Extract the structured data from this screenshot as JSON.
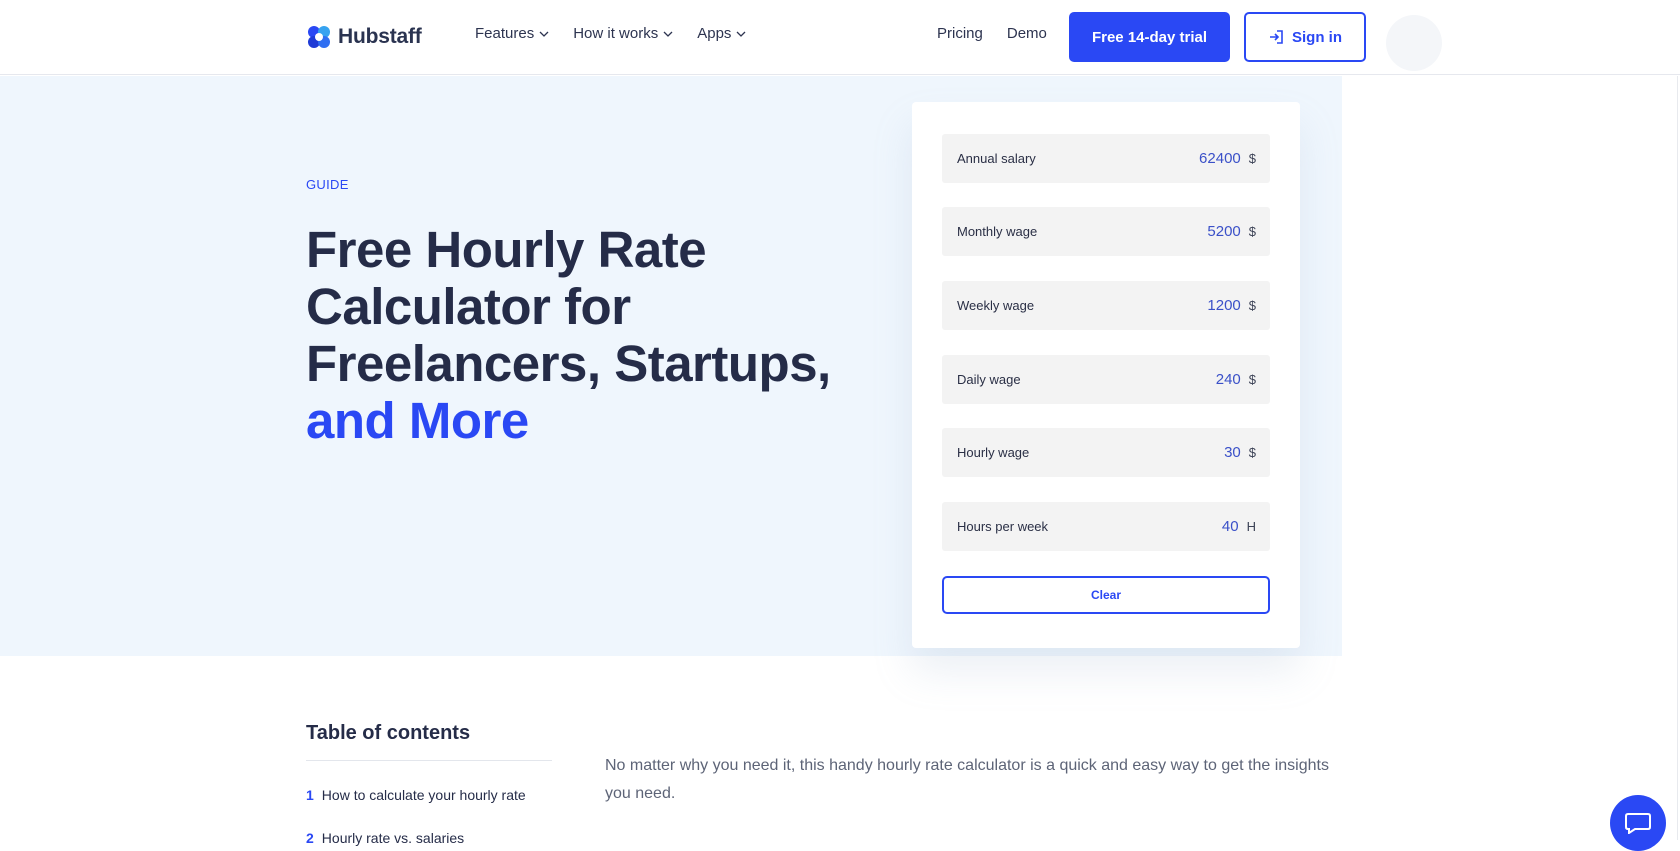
{
  "header": {
    "logo_text": "Hubstaff",
    "nav": [
      {
        "label": "Features"
      },
      {
        "label": "How it works"
      },
      {
        "label": "Apps"
      }
    ],
    "pricing_label": "Pricing",
    "demo_label": "Demo",
    "trial_label": "Free 14-day trial",
    "signin_label": "Sign in"
  },
  "hero": {
    "guide_label": "GUIDE",
    "title_line1": "Free Hourly Rate",
    "title_line2": "Calculator for",
    "title_line3": "Freelancers, Startups,",
    "title_accent": "and More"
  },
  "calculator": {
    "fields": [
      {
        "label": "Annual salary",
        "value": "62400",
        "unit": "$"
      },
      {
        "label": "Monthly wage",
        "value": "5200",
        "unit": "$"
      },
      {
        "label": "Weekly wage",
        "value": "1200",
        "unit": "$"
      },
      {
        "label": "Daily wage",
        "value": "240",
        "unit": "$"
      },
      {
        "label": "Hourly wage",
        "value": "30",
        "unit": "$"
      },
      {
        "label": "Hours per week",
        "value": "40",
        "unit": "H"
      }
    ],
    "clear_label": "Clear"
  },
  "toc": {
    "title": "Table of contents",
    "items": [
      {
        "num": "1",
        "label": "How to calculate your hourly rate"
      },
      {
        "num": "2",
        "label": "Hourly rate vs. salaries"
      }
    ]
  },
  "intro": "No matter why you need it, this handy hourly rate calculator is a quick and easy way to get the insights you need.",
  "colors": {
    "accent": "#2a48f4",
    "hero_bg": "#eff6fd",
    "heading": "#252c48"
  }
}
